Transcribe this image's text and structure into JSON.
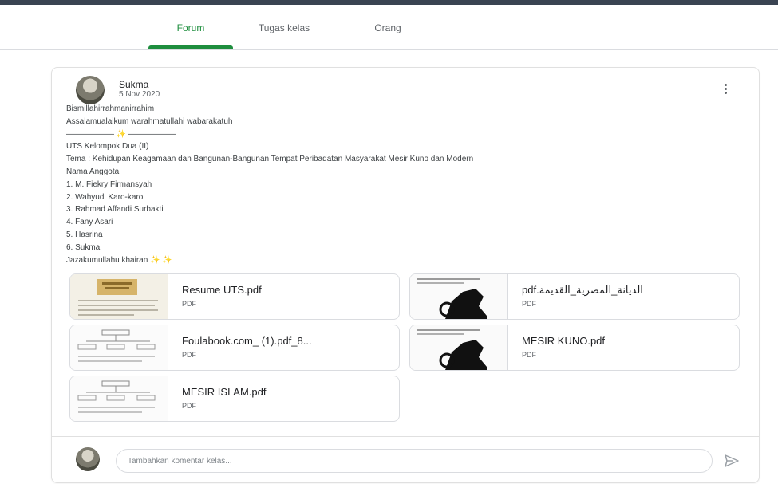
{
  "tabs": [
    {
      "label": "Forum",
      "active": true
    },
    {
      "label": "Tugas kelas",
      "active": false
    },
    {
      "label": "Orang",
      "active": false
    }
  ],
  "post": {
    "author": "Sukma",
    "date": "5 Nov 2020",
    "lines": [
      "Bismillahirrahmanirrahim",
      "Assalamualaikum warahmatullahi wabarakatuh",
      "—————— ✨ ——————",
      "UTS Kelompok Dua (II)",
      "Tema : Kehidupan Keagamaan dan Bangunan-Bangunan Tempat Peribadatan Masyarakat Mesir Kuno dan Modern",
      "Nama Anggota:",
      "1. M. Fiekry Firmansyah",
      "2. Wahyudi Karo-karo",
      "3. Rahmad Affandi Surbakti",
      "4. Fany Asari",
      "5. Hasrina",
      "6. Sukma",
      "Jazakumullahu khairan ✨ ✨"
    ],
    "attachments": [
      {
        "name": "Resume UTS.pdf",
        "type": "PDF",
        "thumb": "doc"
      },
      {
        "name": "pdf.الديانة_المصرية_القديمة",
        "type": "PDF",
        "thumb": "figure"
      },
      {
        "name": "Foulabook.com_ (1).pdf_8...",
        "type": "PDF",
        "thumb": "diagram"
      },
      {
        "name": "MESIR KUNO.pdf",
        "type": "PDF",
        "thumb": "figure"
      },
      {
        "name": "MESIR ISLAM.pdf",
        "type": "PDF",
        "thumb": "diagram"
      }
    ]
  },
  "comment": {
    "placeholder": "Tambahkan komentar kelas..."
  },
  "colors": {
    "accent": "#1e8e3e",
    "topbar": "#3a4452",
    "border": "#dadce0"
  }
}
